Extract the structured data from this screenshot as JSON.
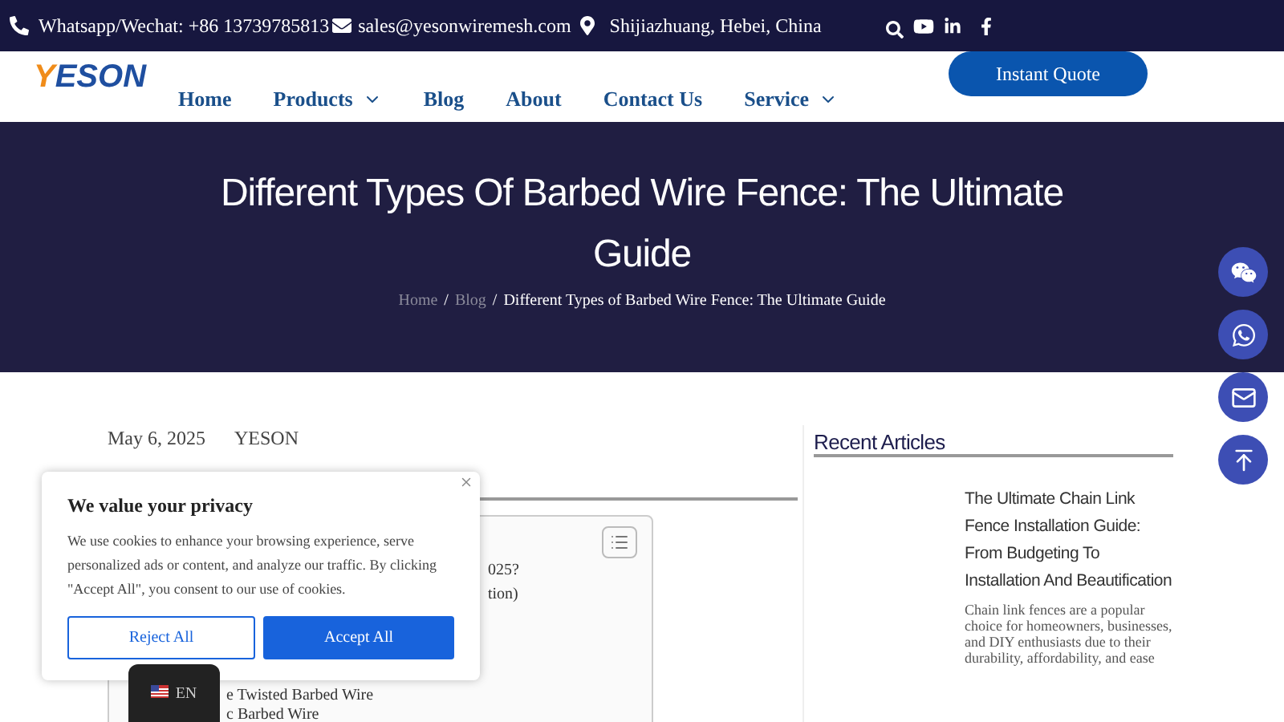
{
  "topbar": {
    "phone": "Whatsapp/Wechat: +86 13739785813",
    "email": "sales@yesonwiremesh.com",
    "address": "Shijiazhuang, Hebei, China"
  },
  "logo": "YESON",
  "nav": [
    {
      "label": "Home",
      "dropdown": false
    },
    {
      "label": "Products",
      "dropdown": true
    },
    {
      "label": "Blog",
      "dropdown": false
    },
    {
      "label": "About",
      "dropdown": false
    },
    {
      "label": "Contact Us",
      "dropdown": false
    },
    {
      "label": "Service",
      "dropdown": true
    }
  ],
  "quote_button": "Instant Quote",
  "hero": {
    "title": "Different Types Of Barbed Wire Fence: The Ultimate Guide",
    "breadcrumb": [
      "Home",
      "Blog",
      "Different Types of Barbed Wire Fence: The Ultimate Guide"
    ],
    "separator": "/"
  },
  "post": {
    "date": "May 6, 2025",
    "author": "YESON"
  },
  "toc_fragments": [
    "025?",
    "tion)",
    "e Twisted Barbed Wire",
    "c Barbed Wire"
  ],
  "sidebar": {
    "heading": "Recent Articles",
    "article": {
      "title": "The Ultimate Chain Link Fence Installation Guide: From Budgeting To Installation And Beautification",
      "excerpt": "Chain link fences are a popular choice for homeowners, businesses, and DIY enthusiasts due to their durability, affordability, and ease"
    }
  },
  "float_buttons": [
    {
      "kind": "wechat"
    },
    {
      "kind": "whatsapp"
    },
    {
      "kind": "mail"
    },
    {
      "kind": "top"
    }
  ],
  "cookie": {
    "title": "We value your privacy",
    "text": "We use cookies to enhance your browsing experience, serve personalized ads or content, and analyze our traffic. By clicking \"Accept All\", you consent to our use of cookies.",
    "reject": "Reject All",
    "accept": "Accept All"
  },
  "language": "EN"
}
